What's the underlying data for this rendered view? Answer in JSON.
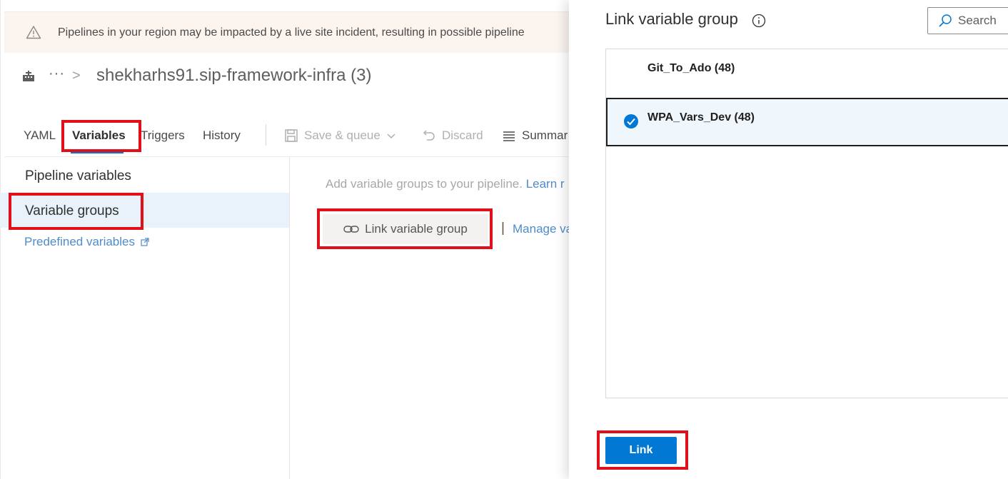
{
  "banner": {
    "text": "Pipelines in your region may be impacted by a live site incident, resulting in possible pipeline",
    "icon": "warning-icon"
  },
  "breadcrumb": {
    "dots": "···",
    "chevron": ">",
    "title": "shekharhs91.sip-framework-infra (3)"
  },
  "tabs": {
    "yaml": "YAML",
    "variables": "Variables",
    "triggers": "Triggers",
    "history": "History"
  },
  "toolbar": {
    "save_queue": "Save & queue",
    "discard": "Discard",
    "summary": "Summar"
  },
  "sidebar": {
    "pipeline_variables": "Pipeline variables",
    "variable_groups": "Variable groups",
    "predefined_variables": "Predefined variables"
  },
  "main": {
    "hint": "Add variable groups to your pipeline.",
    "learn_more": "Learn r",
    "link_variable_group_button": "Link variable group",
    "separator": "|",
    "manage": "Manage va"
  },
  "panel": {
    "title": "Link variable group",
    "search_placeholder": "Search",
    "groups": [
      {
        "name": "Git_To_Ado (48)",
        "selected": false
      },
      {
        "name": "WPA_Vars_Dev (48)",
        "selected": true
      }
    ],
    "link_button": "Link"
  },
  "colors": {
    "accent": "#0078d4",
    "highlight": "#e0101a",
    "selected_row": "#eff6fc",
    "banner_bg": "#fbf4ef"
  }
}
